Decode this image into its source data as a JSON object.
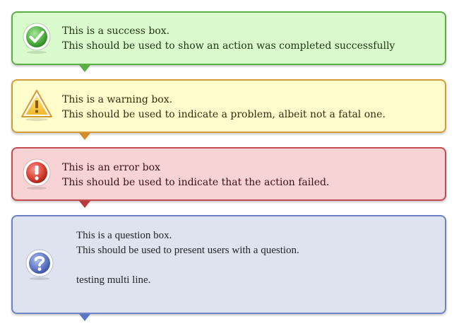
{
  "colors": {
    "success_bg": "#dafccc",
    "success_border": "#5caf45",
    "warning_bg": "#fffdcc",
    "warning_border": "#d99a3c",
    "error_bg": "#f7d3d6",
    "error_border": "#c44c4e",
    "question_bg": "#dfe3ef",
    "question_border": "#6b84c7"
  },
  "boxes": {
    "success": {
      "icon": "checkmark-icon",
      "line1": "This is a success box.",
      "line2": "This should be used to show an action was completed successfully"
    },
    "warning": {
      "icon": "warning-triangle-icon",
      "line1": "This is a warning box.",
      "line2": "This should be used to indicate a problem, albeit not a fatal one."
    },
    "error": {
      "icon": "exclamation-circle-icon",
      "line1": "This is an error box",
      "line2": "This should be used to indicate that the action failed."
    },
    "question": {
      "icon": "question-circle-icon",
      "line1": "This is a question box.",
      "line2": "This should be used to present users with a question.",
      "line3": "testing multi line."
    }
  }
}
